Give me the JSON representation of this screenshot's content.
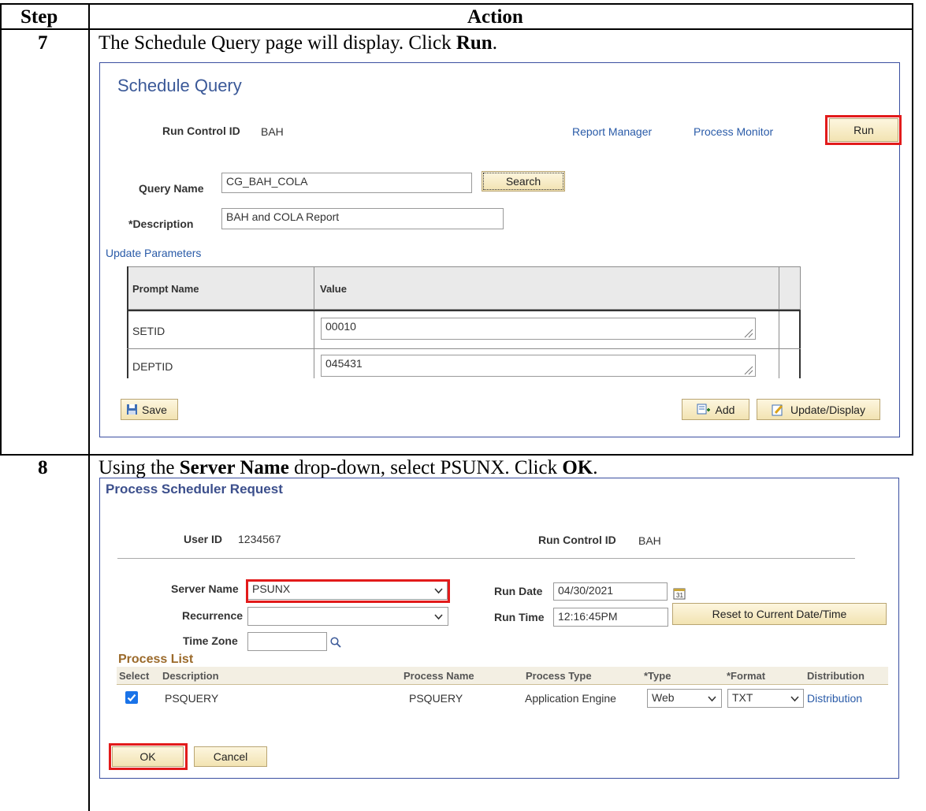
{
  "table": {
    "col_step": "Step",
    "col_action": "Action"
  },
  "step7": {
    "number": "7",
    "text_before": "The Schedule Query page will display.  Click ",
    "text_bold": "Run",
    "text_after": ".",
    "panel": {
      "title": "Schedule Query",
      "run_control_label": "Run Control ID",
      "run_control_value": "BAH",
      "report_manager_link": "Report Manager",
      "process_monitor_link": "Process Monitor",
      "run_button": "Run",
      "query_name_label": "Query Name",
      "query_name_value": "CG_BAH_COLA",
      "search_button": "Search",
      "description_label": "*Description",
      "description_value": "BAH and COLA Report",
      "update_parameters_link": "Update Parameters",
      "grid": {
        "headers": [
          "Prompt Name",
          "Value"
        ],
        "rows": [
          {
            "prompt": "SETID",
            "value": "00010"
          },
          {
            "prompt": "DEPTID",
            "value": "045431"
          }
        ]
      },
      "save_button": "Save",
      "add_button": "Add",
      "update_display_button": "Update/Display"
    }
  },
  "step8": {
    "number": "8",
    "text_1": "Using the ",
    "text_bold_1": "Server Name",
    "text_2": " drop-down, select PSUNX.  Click ",
    "text_bold_2": "OK",
    "text_3": ".",
    "panel": {
      "title": "Process Scheduler Request",
      "user_id_label": "User ID",
      "user_id_value": "1234567",
      "run_control_label": "Run Control ID",
      "run_control_value": "BAH",
      "server_name_label": "Server Name",
      "server_name_value": "PSUNX",
      "run_date_label": "Run Date",
      "run_date_value": "04/30/2021",
      "recurrence_label": "Recurrence",
      "recurrence_value": "",
      "run_time_label": "Run Time",
      "run_time_value": "12:16:45PM",
      "reset_button": "Reset to Current Date/Time",
      "time_zone_label": "Time Zone",
      "time_zone_value": "",
      "process_list_title": "Process List",
      "columns": [
        "Select",
        "Description",
        "Process Name",
        "Process Type",
        "*Type",
        "*Format",
        "Distribution"
      ],
      "row": {
        "selected": true,
        "description": "PSQUERY",
        "process_name": "PSQUERY",
        "process_type": "Application Engine",
        "type": "Web",
        "format": "TXT",
        "distribution": "Distribution"
      },
      "ok_button": "OK",
      "cancel_button": "Cancel"
    }
  },
  "colors": {
    "highlight": "#e21b1b",
    "title_blue": "#3b5998",
    "link_blue": "#2a5ba8",
    "checkbox_blue": "#1a73e8"
  }
}
